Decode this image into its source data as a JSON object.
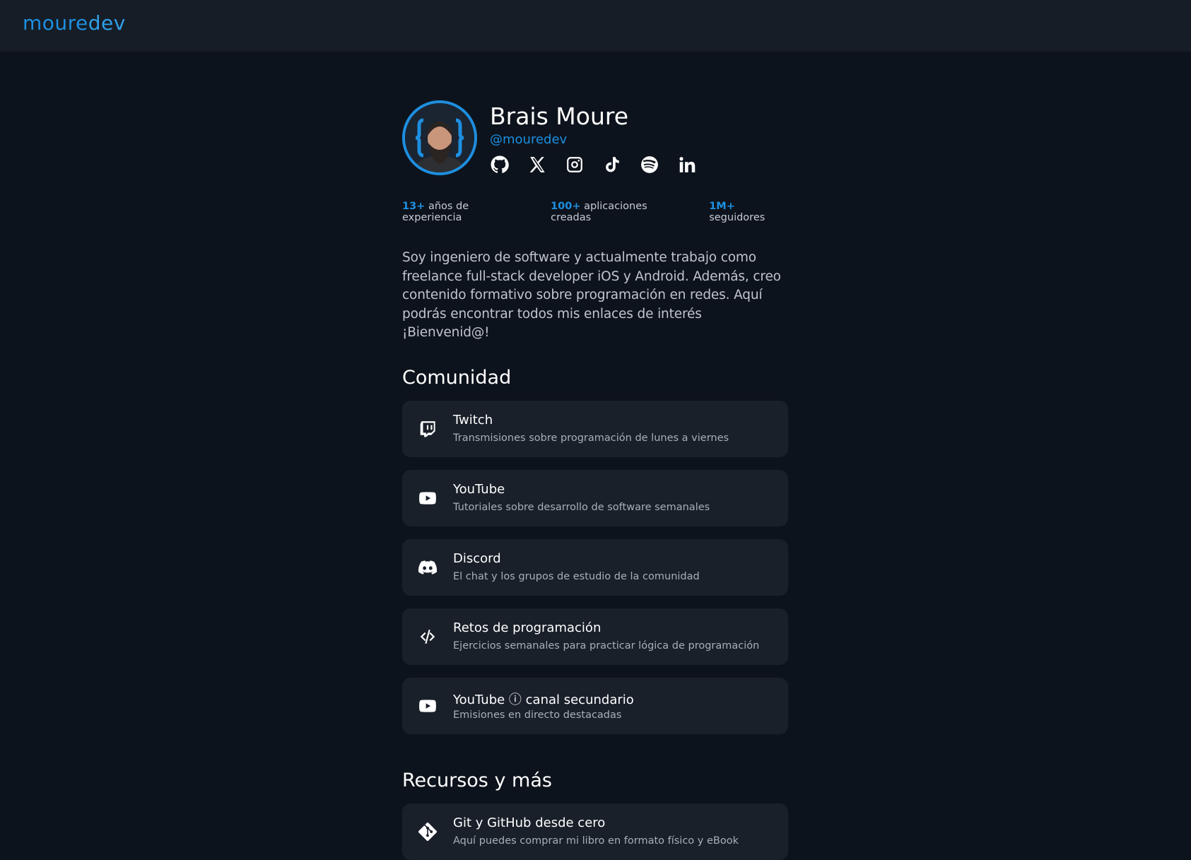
{
  "header": {
    "logo_part1": "moure",
    "logo_part2": "dev"
  },
  "profile": {
    "name": "Brais Moure",
    "handle": "@mouredev",
    "socials": [
      "github-icon",
      "x-icon",
      "instagram-icon",
      "tiktok-icon",
      "spotify-icon",
      "linkedin-icon"
    ]
  },
  "stats": [
    {
      "num": "13+",
      "label": "años de experiencia"
    },
    {
      "num": "100+",
      "label": "aplicaciones creadas"
    },
    {
      "num": "1M+",
      "label": "seguidores"
    }
  ],
  "bio": "Soy ingeniero de software y actualmente trabajo como freelance full-stack developer iOS y Android. Además, creo contenido formativo sobre programación en redes. Aquí podrás encontrar todos mis enlaces de interés ¡Bienvenid@!",
  "sections": [
    {
      "title": "Comunidad",
      "cards": [
        {
          "icon": "twitch-icon",
          "title": "Twitch",
          "sub": "Transmisiones sobre programación de lunes a viernes"
        },
        {
          "icon": "youtube-icon",
          "title": "YouTube",
          "sub": "Tutoriales sobre desarrollo de software semanales"
        },
        {
          "icon": "discord-icon",
          "title": "Discord",
          "sub": "El chat y los grupos de estudio de la comunidad"
        },
        {
          "icon": "code-icon",
          "title": "Retos de programación",
          "sub": "Ejercicios semanales para practicar lógica de programación"
        },
        {
          "icon": "youtube-icon",
          "title": "YouTube ⓘ canal secundario",
          "sub": "Emisiones en directo destacadas"
        }
      ]
    },
    {
      "title": "Recursos y más",
      "cards": [
        {
          "icon": "git-icon",
          "title": "Git y GitHub desde cero",
          "sub": "Aquí puedes comprar mi libro en formato físico y eBook"
        }
      ]
    }
  ],
  "colors": {
    "accent": "#1d8fe0",
    "background": "#0d131c",
    "card": "#19202a"
  }
}
